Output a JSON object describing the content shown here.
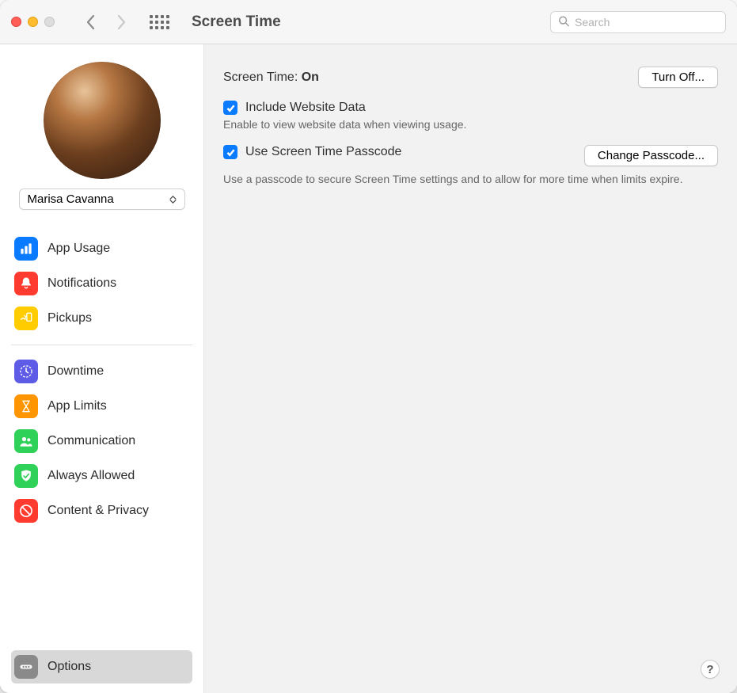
{
  "window": {
    "title": "Screen Time",
    "search_placeholder": "Search"
  },
  "user": {
    "name": "Marisa Cavanna"
  },
  "sidebar": {
    "groups": [
      [
        {
          "id": "app-usage",
          "label": "App Usage",
          "icon": "bar-chart-icon",
          "bg": "#0a7aff"
        },
        {
          "id": "notifications",
          "label": "Notifications",
          "icon": "bell-icon",
          "bg": "#ff3b30"
        },
        {
          "id": "pickups",
          "label": "Pickups",
          "icon": "pickups-icon",
          "bg": "#ffcc00"
        }
      ],
      [
        {
          "id": "downtime",
          "label": "Downtime",
          "icon": "clock-icon",
          "bg": "#5e5ce6"
        },
        {
          "id": "app-limits",
          "label": "App Limits",
          "icon": "hourglass-icon",
          "bg": "#ff9500"
        },
        {
          "id": "communication",
          "label": "Communication",
          "icon": "people-icon",
          "bg": "#30d158"
        },
        {
          "id": "always-allowed",
          "label": "Always Allowed",
          "icon": "check-shield-icon",
          "bg": "#30d158"
        },
        {
          "id": "content-privacy",
          "label": "Content & Privacy",
          "icon": "no-entry-icon",
          "bg": "#ff3b30"
        }
      ]
    ],
    "options_label": "Options"
  },
  "main": {
    "status_label": "Screen Time: ",
    "status_value": "On",
    "turn_off_label": "Turn Off...",
    "website": {
      "checked": true,
      "label": "Include Website Data",
      "desc": "Enable to view website data when viewing usage."
    },
    "passcode": {
      "checked": true,
      "label": "Use Screen Time Passcode",
      "change_label": "Change Passcode...",
      "desc": "Use a passcode to secure Screen Time settings and to allow for more time when limits expire."
    },
    "help": "?"
  },
  "icons": {
    "bar-chart-icon": "bar",
    "bell-icon": "bell",
    "pickups-icon": "pickups",
    "clock-icon": "clock",
    "hourglass-icon": "hourglass",
    "people-icon": "people",
    "check-shield-icon": "shield",
    "no-entry-icon": "noentry",
    "options-icon": "dots"
  }
}
